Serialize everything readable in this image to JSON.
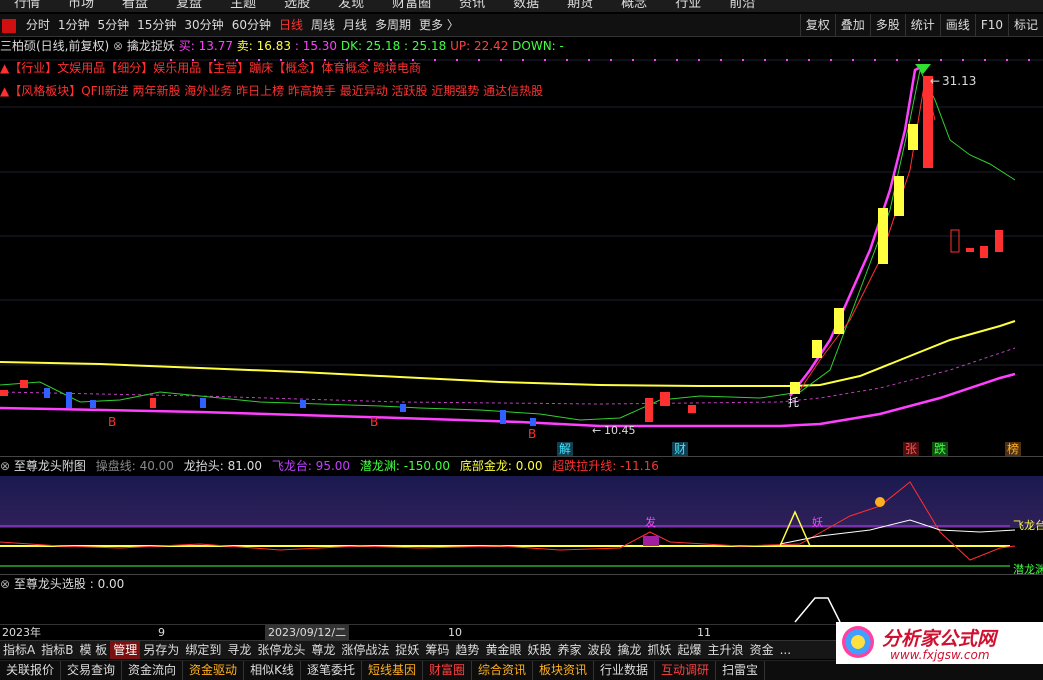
{
  "top_nav": [
    "行情",
    "市场",
    "看盘",
    "复盘",
    "主题",
    "选股",
    "发现",
    "财富圈",
    "资讯",
    "数据",
    "期货",
    "概念",
    "行业",
    "前沿"
  ],
  "periods": [
    "分时",
    "1分钟",
    "5分钟",
    "15分钟",
    "30分钟",
    "60分钟",
    "日线",
    "周线",
    "月线",
    "多周期",
    "更多 〉"
  ],
  "active_period": "日线",
  "tools": [
    "复权",
    "叠加",
    "多股",
    "统计",
    "画线",
    "F10",
    "标记"
  ],
  "stock_line": {
    "name": "三柏硕(日线,前复权)",
    "indicator": "擒龙捉妖",
    "buy": "买: 13.77",
    "sell": "卖: 16.83",
    "v3": ": 15.30",
    "dk": "DK: 25.18",
    "v5": ": 25.18",
    "up": "UP: 22.42",
    "down": "DOWN: -"
  },
  "line2": "▲【行业】文娱用品【细分】娱乐用品【主营】蹦床【概念】体育概念 跨境电商",
  "line3": "▲【风格板块】QFII新进 两年新股 海外业务 昨日上榜 昨高换手 最近异动 活跃股 近期强势 通达信热股",
  "high_label": "31.13",
  "low_label": "10.45",
  "main_tags": {
    "jie": "解",
    "cai": "财",
    "zhang": "张",
    "die": "跌",
    "bang": "榜",
    "tuo": "托",
    "b1": "B",
    "b2": "B",
    "b3": "B"
  },
  "sub1": {
    "title": "至尊龙头附图",
    "a": "操盘线: 40.00",
    "b": "龙抬头: 81.00",
    "c": "飞龙台: 95.00",
    "d": "潜龙渊: -150.00",
    "e": "底部金龙: 0.00",
    "f": "超跌拉升线: -11.16",
    "right_top": "飞龙台",
    "right_bottom": "潜龙渊",
    "tag_fa": "发",
    "tag_yao": "妖"
  },
  "sub2": {
    "title": "至尊龙头选股 : 0.00"
  },
  "axis": {
    "year": "2023年",
    "m9": "9",
    "date": "2023/09/12/二",
    "m10": "10",
    "m11": "11"
  },
  "tabs": [
    "指标A",
    "指标B",
    "模 板",
    "管理",
    "另存为",
    "绑定到",
    "寻龙",
    "张停龙头",
    "尊龙",
    "涨停战法",
    "捉妖",
    "筹码",
    "趋势",
    "黄金眼",
    "妖股",
    "养家",
    "波段",
    "擒龙",
    "抓妖",
    "起爆",
    "主升浪",
    "资金",
    "..."
  ],
  "tab_highlight": "管理",
  "func": [
    "关联报价",
    "交易查询",
    "资金流向",
    "资金驱动",
    "相似K线",
    "逐笔委托",
    "短线基因",
    "财富圈",
    "综合资讯",
    "板块资讯",
    "行业数据",
    "互动调研",
    "扫雷宝"
  ],
  "func_yellow": [
    "资金驱动",
    "短线基因",
    "综合资讯",
    "板块资讯"
  ],
  "func_red": [
    "财富圈",
    "互动调研"
  ],
  "watermark": {
    "title": "分析家公式网",
    "url": "www.fxjgsw.com"
  }
}
